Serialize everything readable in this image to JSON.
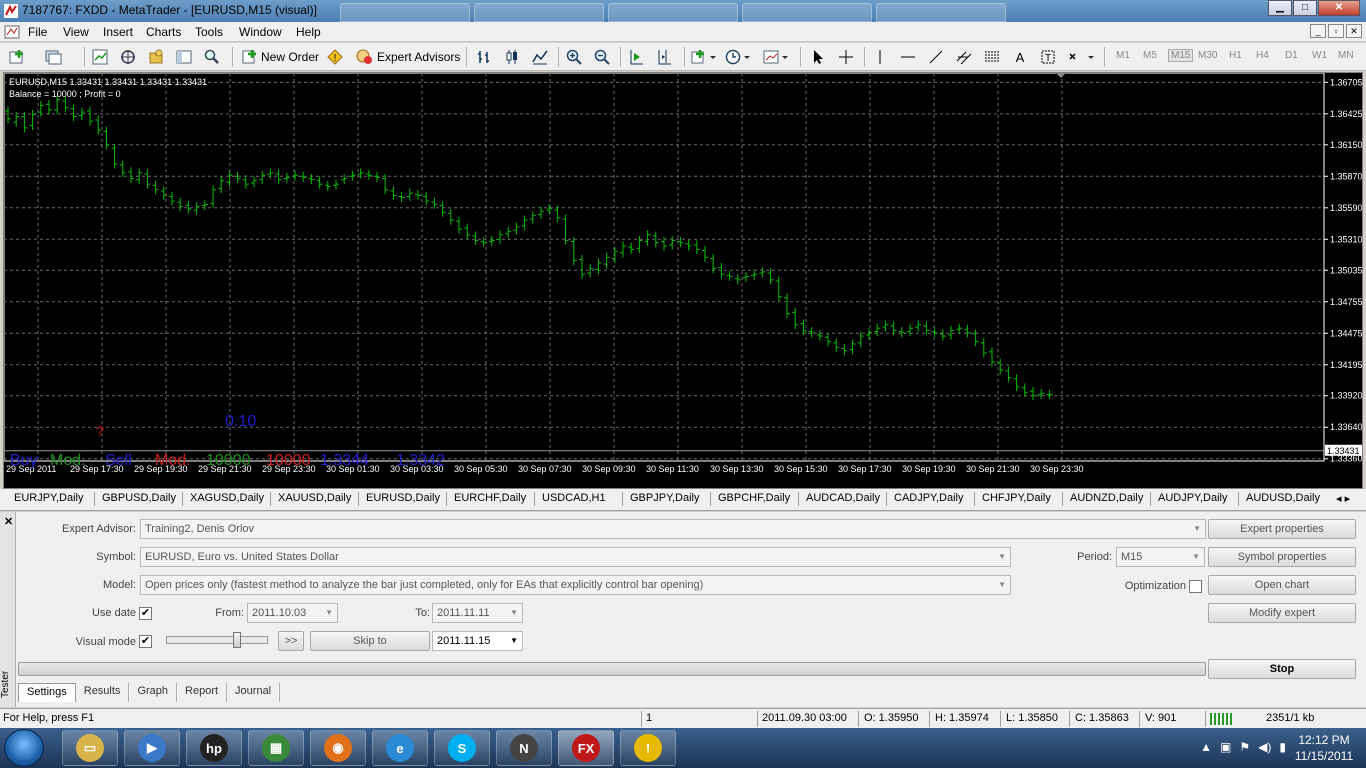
{
  "window": {
    "title": "7187767: FXDD - MetaTrader - [EURUSD,M15 (visual)]",
    "bg_tabs": [
      "",
      "",
      "",
      "",
      ""
    ]
  },
  "menu": [
    "File",
    "View",
    "Insert",
    "Charts",
    "Tools",
    "Window",
    "Help"
  ],
  "toolbar": {
    "new_order": "New Order",
    "expert_advisors": "Expert Advisors",
    "timeframes": [
      "M1",
      "M5",
      "M15",
      "M30",
      "H1",
      "H4",
      "D1",
      "W1",
      "MN"
    ],
    "active_timeframe": "M15"
  },
  "chart": {
    "header": "EURUSD,M15  1.33431 1.33431 1.33431 1.33431",
    "balance": "Balance = 10000 ; Profit = 0",
    "lot": "0.10",
    "question": "?",
    "buttons": [
      {
        "label": "Buy",
        "color": "#1f1fcc"
      },
      {
        "label": "Mod.",
        "color": "#1f8f1f"
      },
      {
        "label": "Sell",
        "color": "#1f1fcc"
      },
      {
        "label": "Mod.",
        "color": "#cc1f1f"
      },
      {
        "label": "10000",
        "color": "#1f8f1f"
      },
      {
        "label": "10000",
        "color": "#cc1f1f"
      },
      {
        "label": "1.3344",
        "color": "#1f1fcc"
      },
      {
        "label": "1.3342",
        "color": "#1f1fcc"
      }
    ],
    "current_price": "1.33431",
    "bar_color": "#00c000",
    "grid_color": "#6b6b6b"
  },
  "chart_data": {
    "type": "bar",
    "title": "EURUSD,M15",
    "price_labels": [
      "1.36705",
      "1.36425",
      "1.36150",
      "1.35870",
      "1.35590",
      "1.35310",
      "1.35035",
      "1.34755",
      "1.34475",
      "1.34195",
      "1.33920",
      "1.33640",
      "1.33360"
    ],
    "time_labels": [
      "29 Sep 2011",
      "29 Sep 17:30",
      "29 Sep 19:30",
      "29 Sep 21:30",
      "29 Sep 23:30",
      "30 Sep 01:30",
      "30 Sep 03:30",
      "30 Sep 05:30",
      "30 Sep 07:30",
      "30 Sep 09:30",
      "30 Sep 11:30",
      "30 Sep 13:30",
      "30 Sep 15:30",
      "30 Sep 17:30",
      "30 Sep 19:30",
      "30 Sep 21:30",
      "30 Sep 23:30"
    ],
    "ylim": [
      1.3334,
      1.3677
    ],
    "close": [
      1.3638,
      1.364,
      1.363,
      1.3642,
      1.365,
      1.3646,
      1.3655,
      1.3648,
      1.364,
      1.3644,
      1.3636,
      1.3628,
      1.3615,
      1.3598,
      1.359,
      1.3585,
      1.359,
      1.358,
      1.3575,
      1.357,
      1.3565,
      1.356,
      1.3558,
      1.356,
      1.3562,
      1.3575,
      1.3583,
      1.3588,
      1.3585,
      1.358,
      1.3583,
      1.3588,
      1.359,
      1.3584,
      1.3586,
      1.3588,
      1.3586,
      1.3584,
      1.358,
      1.3578,
      1.358,
      1.3585,
      1.3588,
      1.359,
      1.3588,
      1.3586,
      1.3575,
      1.357,
      1.3568,
      1.3572,
      1.357,
      1.3565,
      1.3562,
      1.3555,
      1.3548,
      1.354,
      1.3535,
      1.353,
      1.3528,
      1.353,
      1.3535,
      1.3538,
      1.3542,
      1.3548,
      1.3552,
      1.3556,
      1.3558,
      1.355,
      1.353,
      1.3512,
      1.35,
      1.3505,
      1.351,
      1.3515,
      1.352,
      1.3525,
      1.3522,
      1.353,
      1.3535,
      1.3528,
      1.3525,
      1.353,
      1.3528,
      1.3525,
      1.3522,
      1.3515,
      1.3505,
      1.35,
      1.3498,
      1.3495,
      1.3498,
      1.35,
      1.3502,
      1.3495,
      1.348,
      1.3465,
      1.3455,
      1.345,
      1.3448,
      1.3445,
      1.344,
      1.3435,
      1.3432,
      1.3438,
      1.3445,
      1.3448,
      1.3452,
      1.3455,
      1.345,
      1.3448,
      1.3452,
      1.3455,
      1.345,
      1.3448,
      1.3445,
      1.345,
      1.3452,
      1.3448,
      1.344,
      1.343,
      1.3422,
      1.3415,
      1.3408,
      1.34,
      1.3395,
      1.3392,
      1.3394,
      1.3393
    ],
    "open": [
      1.3645,
      1.3635,
      1.364,
      1.3632,
      1.3644,
      1.3651,
      1.3646,
      1.3654,
      1.3647,
      1.3641,
      1.3645,
      1.3637,
      1.3627,
      1.3612,
      1.3597,
      1.3591,
      1.3584,
      1.3589,
      1.3579,
      1.3574,
      1.3569,
      1.3564,
      1.3561,
      1.3557,
      1.3561,
      1.3563,
      1.3576,
      1.3582,
      1.3587,
      1.3584,
      1.3581,
      1.3584,
      1.3589,
      1.3589,
      1.3585,
      1.3587,
      1.3587,
      1.3585,
      1.3583,
      1.3579,
      1.3579,
      1.3584,
      1.3587,
      1.3589,
      1.3589,
      1.3587,
      1.3585,
      1.3574,
      1.3569,
      1.3569,
      1.3571,
      1.3569,
      1.3564,
      1.3561,
      1.3554,
      1.3547,
      1.3541,
      1.3534,
      1.3529,
      1.3529,
      1.3531,
      1.3536,
      1.3539,
      1.3543,
      1.3549,
      1.3553,
      1.3557,
      1.3557,
      1.3549,
      1.3529,
      1.3513,
      1.3501,
      1.3504,
      1.3509,
      1.3514,
      1.3519,
      1.3524,
      1.3523,
      1.3529,
      1.3534,
      1.3529,
      1.3526,
      1.3529,
      1.3527,
      1.3526,
      1.3521,
      1.3514,
      1.3506,
      1.3499,
      1.3496,
      1.3497,
      1.3499,
      1.3501,
      1.3501,
      1.3494,
      1.3479,
      1.3466,
      1.3456,
      1.3449,
      1.3446,
      1.3444,
      1.3439,
      1.3434,
      1.3433,
      1.3439,
      1.3446,
      1.3449,
      1.3453,
      1.3454,
      1.3449,
      1.3449,
      1.3453,
      1.3454,
      1.3449,
      1.3447,
      1.3446,
      1.3451,
      1.3451,
      1.3447,
      1.3439,
      1.3431,
      1.3421,
      1.3414,
      1.3407,
      1.3399,
      1.3396,
      1.3393,
      1.3393
    ]
  },
  "symbol_tabs": [
    "EURJPY,Daily",
    "GBPUSD,Daily",
    "XAGUSD,Daily",
    "XAUUSD,Daily",
    "EURUSD,Daily",
    "EURCHF,Daily",
    "USDCAD,H1",
    "GBPJPY,Daily",
    "GBPCHF,Daily",
    "AUDCAD,Daily",
    "CADJPY,Daily",
    "CHFJPY,Daily",
    "AUDNZD,Daily",
    "AUDJPY,Daily",
    "AUDUSD,Daily"
  ],
  "tester": {
    "side_label": "Tester",
    "expert_advisor_label": "Expert Advisor:",
    "expert_advisor": "Training2, Denis Orlov",
    "symbol_label": "Symbol:",
    "symbol": "EURUSD, Euro vs. United States Dollar",
    "model_label": "Model:",
    "model": "Open prices only (fastest method to analyze the bar just completed, only for EAs that explicitly control bar opening)",
    "period_label": "Period:",
    "period": "M15",
    "optimization_label": "Optimization",
    "use_date_label": "Use date",
    "from_label": "From:",
    "from": "2011.10.03",
    "to_label": "To:",
    "to": "2011.11.11",
    "visual_mode_label": "Visual mode",
    "skip_label": ">>",
    "skip_to_label": "Skip to",
    "skip_date": "2011.11.15",
    "buttons": {
      "expert_properties": "Expert properties",
      "symbol_properties": "Symbol properties",
      "open_chart": "Open chart",
      "modify_expert": "Modify expert",
      "stop": "Stop"
    },
    "tabs": [
      "Settings",
      "Results",
      "Graph",
      "Report",
      "Journal"
    ],
    "active_tab": "Settings",
    "use_date_checked": "✔",
    "visual_mode_checked": "✔",
    "speed_fraction": 0.7
  },
  "status": {
    "help": "For Help, press F1",
    "profile": "1",
    "time": "2011.09.30 03:00",
    "open": "O: 1.35950",
    "high": "H: 1.35974",
    "low": "L: 1.35850",
    "close": "C: 1.35863",
    "volume": "V: 901",
    "traffic": "2351/1 kb"
  },
  "taskbar": {
    "time": "12:12 PM",
    "date": "11/15/2011",
    "apps": [
      {
        "name": "explorer-icon",
        "glyph": "▭",
        "color": "#d9b44a"
      },
      {
        "name": "media-player-icon",
        "glyph": "▶",
        "color": "#3a78c8"
      },
      {
        "name": "hp-icon",
        "glyph": "hp",
        "color": "#222"
      },
      {
        "name": "monitor-app-icon",
        "glyph": "▦",
        "color": "#3b8a3b"
      },
      {
        "name": "firefox-icon",
        "glyph": "◉",
        "color": "#e0701a"
      },
      {
        "name": "ie-icon",
        "glyph": "e",
        "color": "#2a8ad4"
      },
      {
        "name": "skype-icon",
        "glyph": "S",
        "color": "#00aff0"
      },
      {
        "name": "app-n-icon",
        "glyph": "N",
        "color": "#444"
      },
      {
        "name": "fxdd-icon",
        "glyph": "FX",
        "color": "#c01818"
      },
      {
        "name": "warning-app-icon",
        "glyph": "!",
        "color": "#e6b800"
      }
    ]
  }
}
